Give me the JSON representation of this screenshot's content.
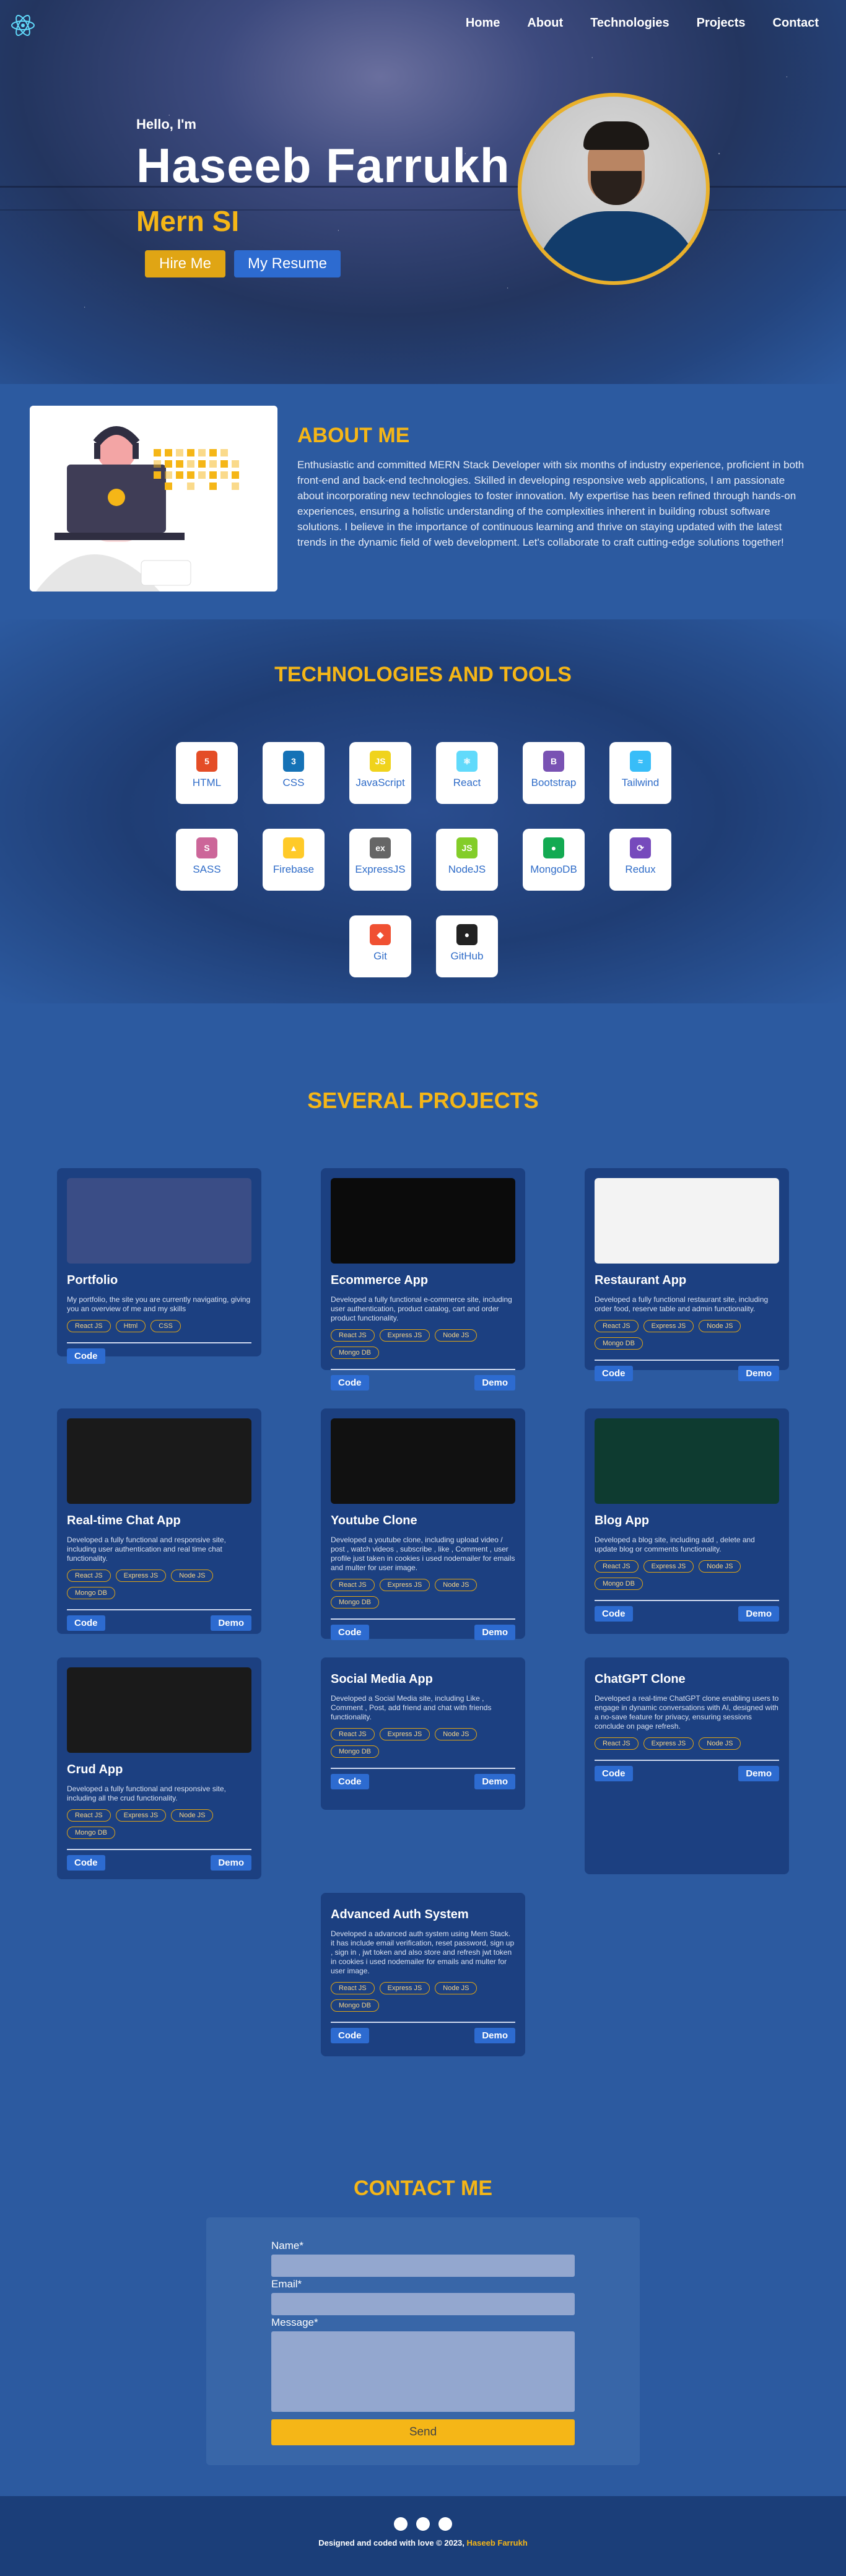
{
  "nav": {
    "items": [
      "Home",
      "About",
      "Technologies",
      "Projects",
      "Contact"
    ]
  },
  "hero": {
    "greeting": "Hello, I'm",
    "name": "Haseeb Farrukh",
    "role": "Mern SI",
    "hire_label": "Hire Me",
    "resume_label": "My Resume"
  },
  "about": {
    "title": "ABOUT ME",
    "text": "Enthusiastic and committed MERN Stack Developer with six months of industry experience, proficient in both front-end and back-end technologies. Skilled in developing responsive web applications, I am passionate about incorporating new technologies to foster innovation. My expertise has been refined through hands-on experiences, ensuring a holistic understanding of the complexities inherent in building robust software solutions. I believe in the importance of continuous learning and thrive on staying updated with the latest trends in the dynamic field of web development. Let's collaborate to craft cutting-edge solutions together!"
  },
  "tech": {
    "title": "TECHNOLOGIES AND TOOLS",
    "items": [
      {
        "label": "HTML",
        "icon": "5",
        "color": "#e44d26"
      },
      {
        "label": "CSS",
        "icon": "3",
        "color": "#1572b6"
      },
      {
        "label": "JavaScript",
        "icon": "JS",
        "color": "#f0d31c"
      },
      {
        "label": "React",
        "icon": "⚛",
        "color": "#61dafb"
      },
      {
        "label": "Bootstrap",
        "icon": "B",
        "color": "#7952b3"
      },
      {
        "label": "Tailwind",
        "icon": "≈",
        "color": "#38bdf8"
      },
      {
        "label": "SASS",
        "icon": "S",
        "color": "#cc6699"
      },
      {
        "label": "Firebase",
        "icon": "▲",
        "color": "#ffca28"
      },
      {
        "label": "ExpressJS",
        "icon": "ex",
        "color": "#666"
      },
      {
        "label": "NodeJS",
        "icon": "JS",
        "color": "#83cd29"
      },
      {
        "label": "MongoDB",
        "icon": "●",
        "color": "#13aa52"
      },
      {
        "label": "Redux",
        "icon": "⟳",
        "color": "#764abc"
      },
      {
        "label": "Git",
        "icon": "◆",
        "color": "#f05032"
      },
      {
        "label": "GitHub",
        "icon": "●",
        "color": "#222"
      }
    ]
  },
  "projects": {
    "title": "SEVERAL PROJECTS",
    "items": [
      {
        "title": "Portfolio",
        "desc": "My portfolio, the site you are currently navigating, giving you an overview of me and my skills",
        "tags": [
          "React JS",
          "Html",
          "CSS"
        ],
        "code": "Code",
        "demo": ""
      },
      {
        "title": "Ecommerce App",
        "desc": "Developed a fully functional e-commerce site, including user authentication, product catalog, cart and order product functionality.",
        "tags": [
          "React JS",
          "Express JS",
          "Node JS",
          "Mongo DB"
        ],
        "code": "Code",
        "demo": "Demo"
      },
      {
        "title": "Restaurant App",
        "desc": "Developed a fully functional restaurant site, including order food, reserve table and admin functionality.",
        "tags": [
          "React JS",
          "Express JS",
          "Node JS",
          "Mongo DB"
        ],
        "code": "Code",
        "demo": "Demo"
      },
      {
        "title": "Real-time Chat App",
        "desc": "Developed a fully functional and responsive site, including user authentication and real time chat functionality.",
        "tags": [
          "React JS",
          "Express JS",
          "Node JS",
          "Mongo DB"
        ],
        "code": "Code",
        "demo": "Demo"
      },
      {
        "title": "Youtube Clone",
        "desc": "Developed a youtube clone, including upload video / post , watch videos , subscribe , like , Comment , user profile just taken in cookies i used nodemailer for emails and multer for user image.",
        "tags": [
          "React JS",
          "Express JS",
          "Node JS",
          "Mongo DB"
        ],
        "code": "Code",
        "demo": "Demo"
      },
      {
        "title": "Blog App",
        "desc": "Developed a blog site, including add , delete and update blog or comments functionality.",
        "tags": [
          "React JS",
          "Express JS",
          "Node JS",
          "Mongo DB"
        ],
        "code": "Code",
        "demo": "Demo"
      },
      {
        "title": "Crud App",
        "desc": "Developed a fully functional and responsive site, including all the crud functionality.",
        "tags": [
          "React JS",
          "Express JS",
          "Node JS",
          "Mongo DB"
        ],
        "code": "Code",
        "demo": "Demo"
      },
      {
        "title": "Social Media App",
        "desc": "Developed a Social Media site, including Like , Comment , Post, add friend and chat with friends functionality.",
        "tags": [
          "React JS",
          "Express JS",
          "Node JS",
          "Mongo DB"
        ],
        "code": "Code",
        "demo": "Demo"
      },
      {
        "title": "ChatGPT Clone",
        "desc": "Developed a real-time ChatGPT clone enabling users to engage in dynamic conversations with AI, designed with a no-save feature for privacy, ensuring sessions conclude on page refresh.",
        "tags": [
          "React JS",
          "Express JS",
          "Node JS"
        ],
        "code": "Code",
        "demo": "Demo"
      },
      {
        "title": "Advanced Auth System",
        "desc": "Developed a advanced auth system using Mern Stack. it has include email verification, reset password, sign up , sign in , jwt token and also store and refresh jwt token in cookies i used nodemailer for emails and multer for user image.",
        "tags": [
          "React JS",
          "Express JS",
          "Node JS",
          "Mongo DB"
        ],
        "code": "Code",
        "demo": "Demo"
      }
    ]
  },
  "contact": {
    "title": "CONTACT ME",
    "name_label": "Name*",
    "email_label": "Email*",
    "message_label": "Message*",
    "send_label": "Send"
  },
  "footer": {
    "text": "Designed and coded with love © 2023, ",
    "name": "Haseeb Farrukh"
  }
}
